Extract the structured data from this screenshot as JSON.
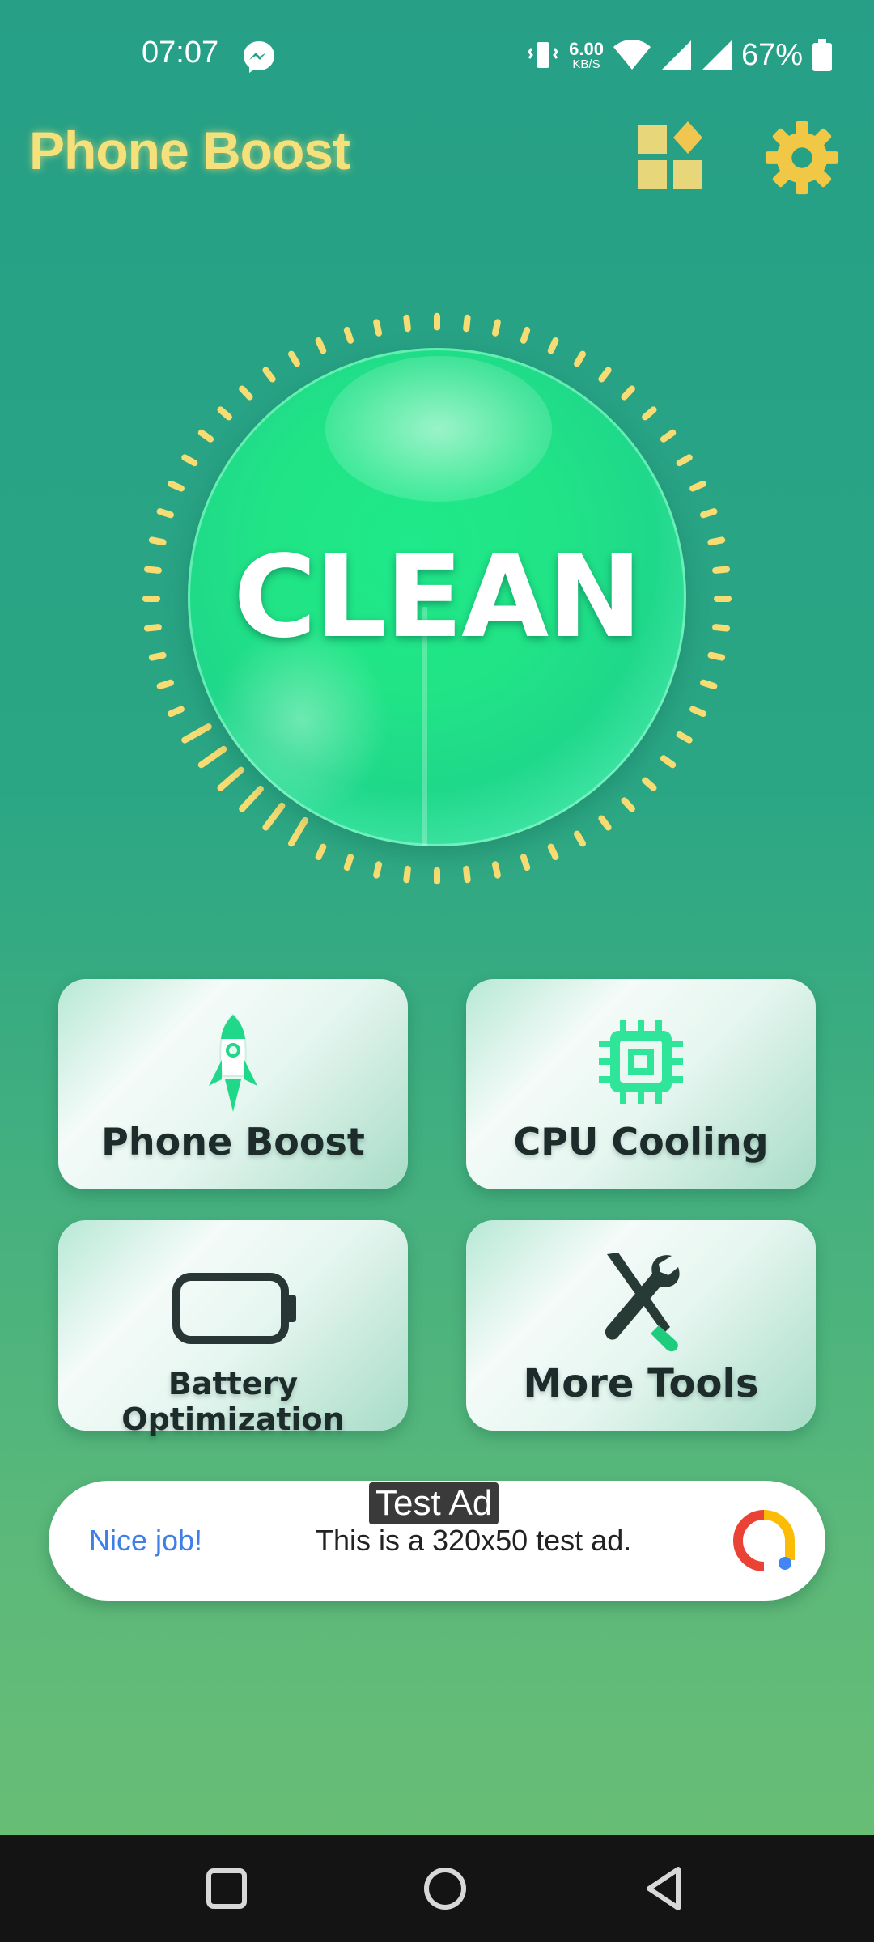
{
  "status_bar": {
    "time": "07:07",
    "speed_value": "6.00",
    "speed_unit": "KB/S",
    "battery_percent": "67%",
    "icons": [
      "messenger-icon",
      "vibrate-icon",
      "wifi-icon",
      "signal-icon",
      "signal-icon",
      "battery-icon"
    ]
  },
  "header": {
    "title": "Phone Boost",
    "icons": [
      "widgets-icon",
      "gear-icon"
    ]
  },
  "main": {
    "clean_label": "CLEAN"
  },
  "tools": [
    {
      "label": "Phone Boost",
      "icon": "rocket-icon"
    },
    {
      "label": "CPU Cooling",
      "icon": "cpu-icon"
    },
    {
      "label": "Battery Optimization",
      "icon": "battery-icon"
    },
    {
      "label": "More Tools",
      "icon": "tools-icon"
    }
  ],
  "ad": {
    "tag": "Test Ad",
    "headline": "Nice job!",
    "body": "This is a 320x50 test ad.",
    "icon": "adchoices-logo-icon"
  },
  "nav": {
    "icons": [
      "recents-square-icon",
      "home-circle-icon",
      "back-triangle-icon"
    ]
  },
  "colors": {
    "background_top": "#269f86",
    "background_bottom": "#6cbf73",
    "title": "#f6e07a",
    "accent_green": "#20e486",
    "ad_headline": "#3f7fe8"
  }
}
